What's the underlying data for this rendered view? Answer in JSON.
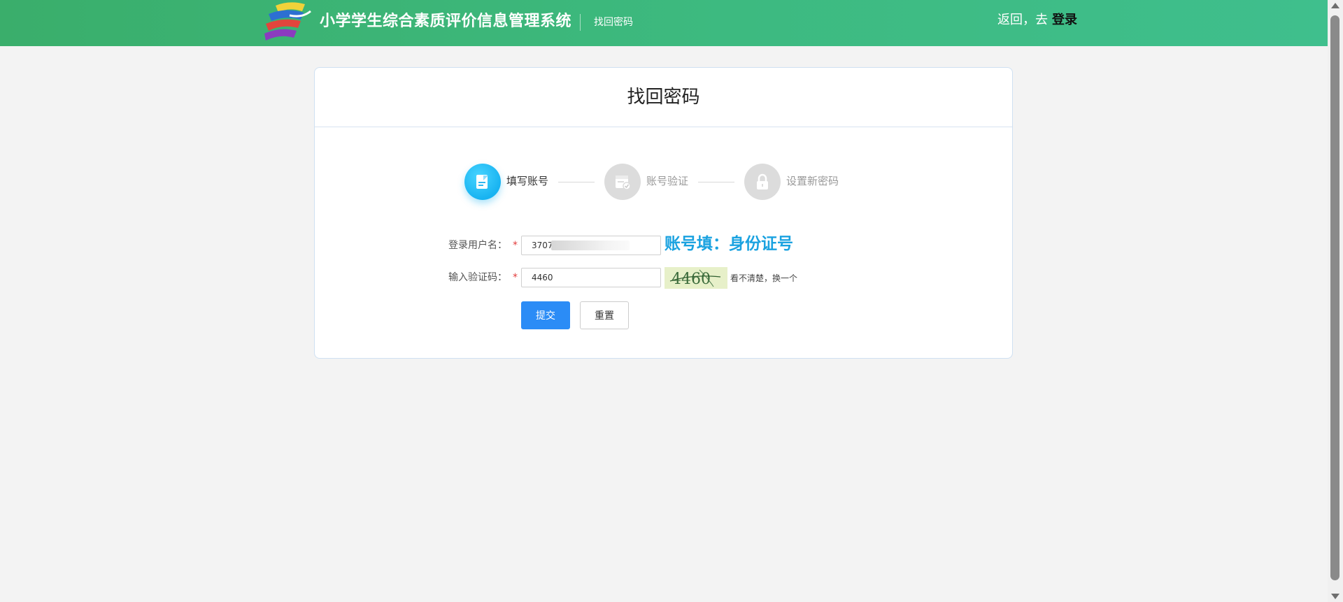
{
  "header": {
    "app_title": "小学学生综合素质评价信息管理系统",
    "subtitle": "找回密码",
    "back_prefix": "返回，去",
    "login_link": "登录",
    "colors": {
      "bar_start": "#3aae6b",
      "bar_end": "#3fbf8d"
    },
    "logo_icon": "school-logo-icon"
  },
  "card": {
    "title": "找回密码",
    "steps": [
      {
        "label": "填写账号",
        "state": "active",
        "icon": "edit-document-icon"
      },
      {
        "label": "账号验证",
        "state": "inactive",
        "icon": "calendar-check-icon"
      },
      {
        "label": "设置新密码",
        "state": "inactive",
        "icon": "lock-icon"
      }
    ],
    "form": {
      "username_label": "登录用户名：",
      "username_value": "3707",
      "username_hint": "账号填：身份证号",
      "captcha_label": "输入验证码：",
      "captcha_value": "4460",
      "captcha_image_text": "4460",
      "captcha_refresh": "看不清楚，换一个",
      "required_mark": "*"
    },
    "buttons": {
      "submit": "提交",
      "reset": "重置"
    },
    "colors": {
      "accent": "#2b8cf6",
      "step_active": "#18b3f1",
      "hint": "#1aa2e0",
      "required": "#e23b3b"
    }
  }
}
